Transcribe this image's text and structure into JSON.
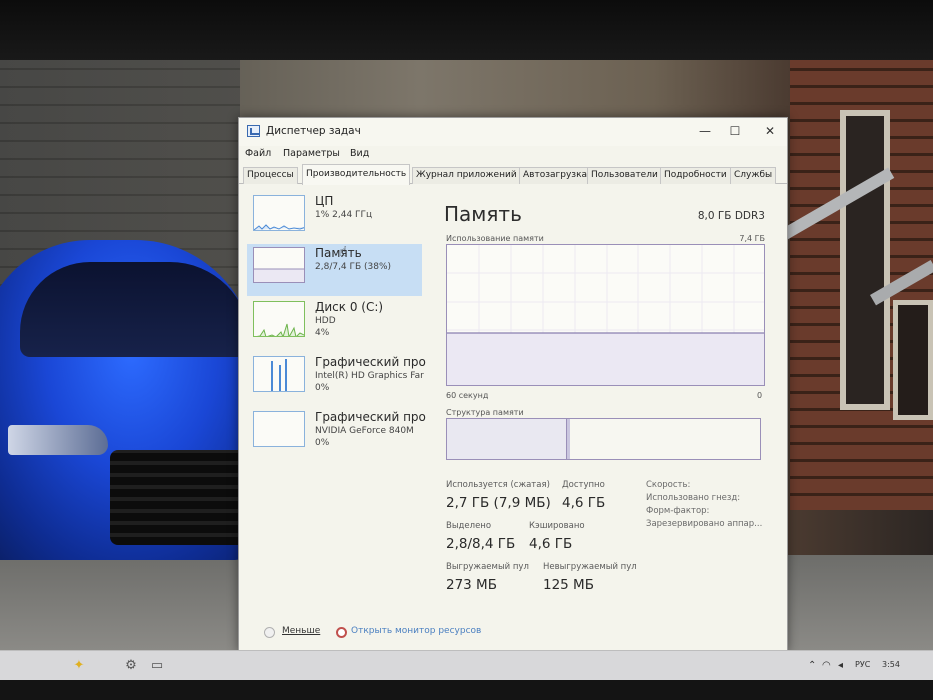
{
  "window": {
    "title": "Диспетчер задач",
    "controls": {
      "minimize": "—",
      "maximize": "☐",
      "close": "✕"
    }
  },
  "menu": [
    "Файл",
    "Параметры",
    "Вид"
  ],
  "tabs": [
    "Процессы",
    "Производительность",
    "Журнал приложений",
    "Автозагрузка",
    "Пользователи",
    "Подробности",
    "Службы"
  ],
  "active_tab": "Производительность",
  "resources": [
    {
      "name": "ЦП",
      "line1": "1% 2,44 ГГц",
      "line2": ""
    },
    {
      "name": "Память",
      "line1": "2,8/7,4 ГБ (38%)",
      "line2": ""
    },
    {
      "name": "Диск 0 (C:)",
      "line1": "HDD",
      "line2": "4%"
    },
    {
      "name": "Графический про",
      "line1": "Intel(R) HD Graphics Far",
      "line2": "0%"
    },
    {
      "name": "Графический про",
      "line1": "NVIDIA GeForce 840M",
      "line2": "0%"
    }
  ],
  "memory": {
    "title": "Память",
    "spec": "8,0 ГБ DDR3",
    "usage_label": "Использование памяти",
    "usage_max": "7,4 ГБ",
    "time_left": "60 секунд",
    "time_right": "0",
    "structure_label": "Структура памяти",
    "usage_fraction": 0.38,
    "stats": {
      "in_use_label": "Используется (сжатая)",
      "in_use_value": "2,7 ГБ (7,9 МБ)",
      "available_label": "Доступно",
      "available_value": "4,6 ГБ",
      "committed_label": "Выделено",
      "committed_value": "2,8/8,4 ГБ",
      "cached_label": "Кэшировано",
      "cached_value": "4,6 ГБ",
      "paged_label": "Выгружаемый пул",
      "paged_value": "273 МБ",
      "nonpaged_label": "Невыгружаемый пул",
      "nonpaged_value": "125 МБ"
    },
    "side": [
      "Скорость:",
      "Использовано гнезд:",
      "Форм-фактор:",
      "Зарезервировано аппар..."
    ]
  },
  "footer": {
    "less": "Меньше",
    "monitor": "Открыть монитор ресурсов"
  },
  "tray": {
    "lang": "РУС",
    "time": "3:54"
  },
  "colors": {
    "accent": "#c7def4",
    "cpu": "#4b8ad6",
    "memory": "#9a8fb8",
    "disk": "#6bb34a",
    "gpu": "#4b8ad6"
  }
}
